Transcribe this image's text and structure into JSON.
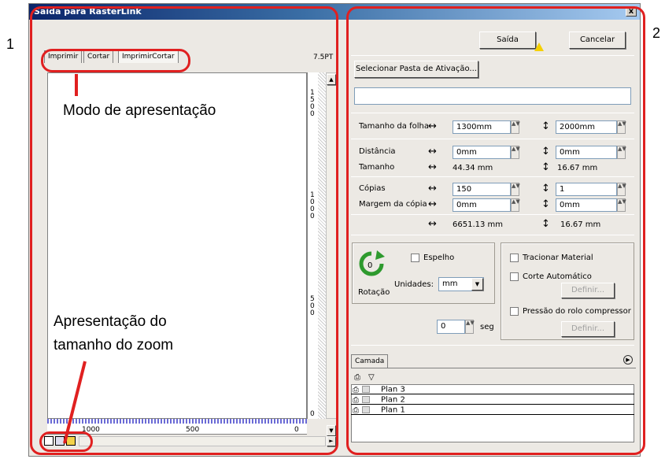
{
  "window": {
    "title": "Saída para RasterLink",
    "close_symbol": "x"
  },
  "corner_labels": {
    "left": "1",
    "right": "2"
  },
  "preview": {
    "tabs": [
      "Imprimir",
      "Cortar",
      "ImprimirCortar"
    ],
    "size_label": "7.5PT",
    "ruler_vertical": [
      "1",
      "5",
      "0",
      "0",
      "1",
      "0",
      "0",
      "0",
      "5",
      "0",
      "0",
      "0"
    ],
    "ruler_bottom": [
      "1000",
      "500",
      "0"
    ],
    "scroll_up": "▲",
    "scroll_down": "▼",
    "scroll_right": "►"
  },
  "callouts": {
    "display_mode": "Modo de apresentação",
    "zoom_line1": "Apresentação do",
    "zoom_line2": "tamanho do zoom"
  },
  "actions": {
    "output": "Saída",
    "cancel": "Cancelar",
    "select_folder": "Selecionar Pasta de Ativação...",
    "folder_path": ""
  },
  "sheet": {
    "label": "Tamanho da folha",
    "width": "1300mm",
    "height": "2000mm"
  },
  "distance": {
    "label": "Distância",
    "x": "0mm",
    "y": "0mm"
  },
  "size": {
    "label": "Tamanho",
    "x": "44.34 mm",
    "y": "16.67 mm"
  },
  "copies": {
    "label": "Cópias",
    "x": "150",
    "y": "1"
  },
  "margin": {
    "label": "Margem da cópia",
    "x": "0mm",
    "y": "0mm"
  },
  "totals": {
    "x": "6651.13 mm",
    "y": "16.67 mm"
  },
  "arrows": {
    "horizontal": "↔",
    "vertical": "↕"
  },
  "rotation": {
    "label": "Rotação",
    "value": "0",
    "mirror": "Espelho",
    "units_label": "Unidades:",
    "units_value": "mm"
  },
  "options": {
    "pull_material": "Tracionar Material",
    "auto_cut": "Corte Automático",
    "define1": "Definir...",
    "pinch_roller": "Pressão do rolo compressor",
    "define2": "Definir...",
    "seconds_value": "0",
    "seconds_unit": "seg"
  },
  "layers": {
    "tab": "Camada",
    "rows": [
      "Plan 3",
      "Plan 2",
      "Plan 1"
    ]
  }
}
